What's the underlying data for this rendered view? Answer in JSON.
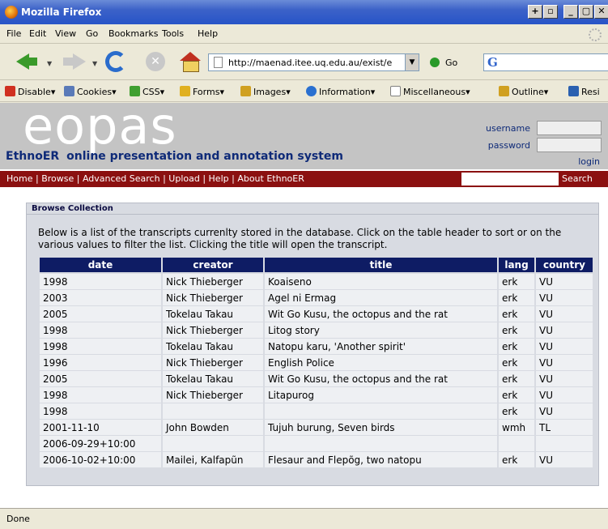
{
  "window": {
    "title": "Mozilla Firefox",
    "controls": [
      "+",
      "▫",
      "_",
      "▢",
      "✕"
    ]
  },
  "menu": [
    "File",
    "Edit",
    "View",
    "Go",
    "Bookmarks",
    "Tools",
    "Help"
  ],
  "toolbar": {
    "url": "http://maenad.itee.uq.edu.au/exist/e",
    "go_label": "Go",
    "search_engine_glyph": "G"
  },
  "devbar": {
    "items": [
      {
        "label": "Disable",
        "icon": "disable-icon",
        "color": "#d03020"
      },
      {
        "label": "Cookies",
        "icon": "cookies-icon",
        "color": "#5a7ab8"
      },
      {
        "label": "CSS",
        "icon": "css-icon",
        "color": "#40a030"
      },
      {
        "label": "Forms",
        "icon": "forms-icon",
        "color": "#e0b020"
      },
      {
        "label": "Images",
        "icon": "images-icon",
        "color": "#d0a020"
      },
      {
        "label": "Information",
        "icon": "information-icon",
        "color": "#2a70d0"
      },
      {
        "label": "Miscellaneous",
        "icon": "miscellaneous-icon",
        "color": "#808080"
      },
      {
        "label": "Outline",
        "icon": "outline-icon",
        "color": "#d0a020"
      },
      {
        "label": "Resi",
        "icon": "resize-icon",
        "color": "#2a60b0"
      }
    ]
  },
  "site": {
    "logo": "eopas",
    "tagline_ethno": "EthnoER",
    "tagline_rest": "online presentation and annotation system",
    "username_label": "username",
    "password_label": "password",
    "login_label": "login",
    "nav": [
      "Home",
      "Browse",
      "Advanced Search",
      "Upload",
      "Help",
      "About EthnoER"
    ],
    "search_label": "Search"
  },
  "browse": {
    "title": "Browse Collection",
    "intro": "Below is a list of the transcripts currenlty stored in the database. Click on the table header to sort or on the various values to filter the list. Clicking the title will open the transcript.",
    "columns": [
      "date",
      "creator",
      "title",
      "lang",
      "country"
    ],
    "rows": [
      [
        "1998",
        "Nick Thieberger",
        "Koaiseno",
        "erk",
        "VU"
      ],
      [
        "2003",
        "Nick Thieberger",
        "Agel ni Ermag",
        "erk",
        "VU"
      ],
      [
        "2005",
        "Tokelau Takau",
        "Wit Go Kusu, the octopus and the rat",
        "erk",
        "VU"
      ],
      [
        "1998",
        "Nick Thieberger",
        "Litog story",
        "erk",
        "VU"
      ],
      [
        "1998",
        "Tokelau Takau",
        "Natopu karu, 'Another spirit'",
        "erk",
        "VU"
      ],
      [
        "1996",
        "Nick Thieberger",
        "English Police",
        "erk",
        "VU"
      ],
      [
        "2005",
        "Tokelau Takau",
        "Wit Go Kusu, the octopus and the rat",
        "erk",
        "VU"
      ],
      [
        "1998",
        "Nick Thieberger",
        "Litapurog",
        "erk",
        "VU"
      ],
      [
        "1998",
        "",
        "",
        "erk",
        "VU"
      ],
      [
        "2001-11-10",
        "John Bowden",
        "Tujuh burung, Seven birds",
        "wmh",
        "TL"
      ],
      [
        "2006-09-29+10:00",
        "",
        "",
        "",
        ""
      ],
      [
        "2006-10-02+10:00",
        "Mailei, Kalfapũn",
        "Flesaur and Flepõg, two natopu",
        "erk",
        "VU"
      ]
    ]
  },
  "status": "Done"
}
